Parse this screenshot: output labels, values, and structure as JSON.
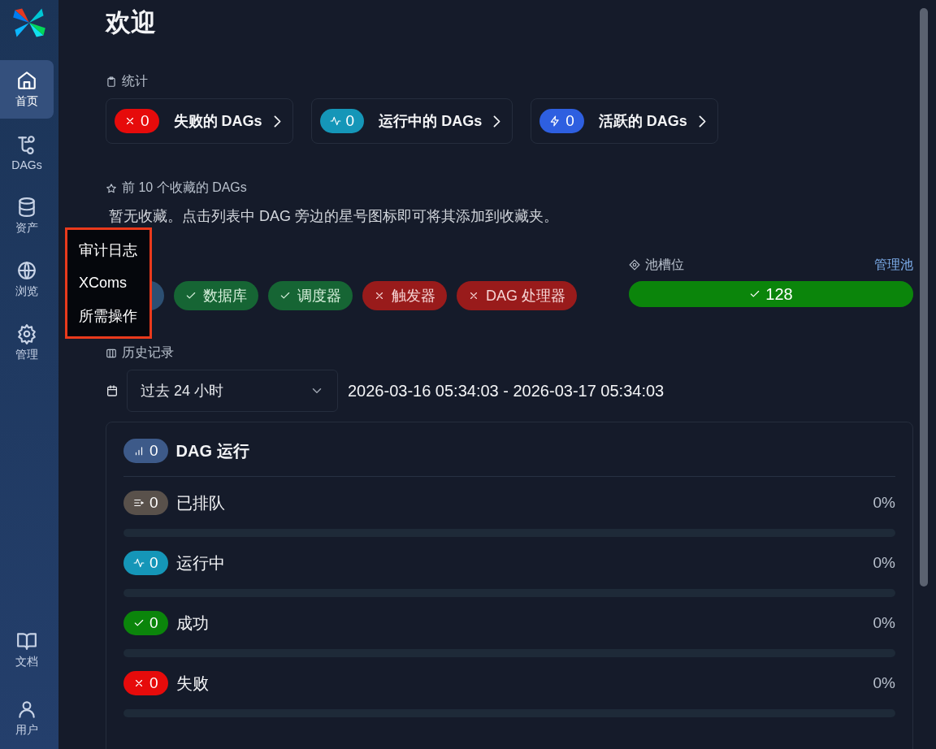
{
  "sidebar": {
    "items": [
      {
        "label": "首页",
        "selected": true
      },
      {
        "label": "DAGs",
        "selected": false
      },
      {
        "label": "资产",
        "selected": false
      },
      {
        "label": "浏览",
        "selected": false
      },
      {
        "label": "管理",
        "selected": false
      }
    ],
    "bottom_items": [
      {
        "label": "文档",
        "selected": false
      },
      {
        "label": "用户",
        "selected": false
      }
    ]
  },
  "popup_menu": {
    "items": [
      "审计日志",
      "XComs",
      "所需操作"
    ]
  },
  "title": "欢迎",
  "stats": {
    "heading": "统计",
    "cards": [
      {
        "kind": "failed",
        "count": "0",
        "label": "失败的 DAGs"
      },
      {
        "kind": "running",
        "count": "0",
        "label": "运行中的 DAGs"
      },
      {
        "kind": "active",
        "count": "0",
        "label": "活跃的 DAGs"
      }
    ]
  },
  "favorites": {
    "heading": "前 10 个收藏的 DAGs",
    "message": "暂无收藏。点击列表中 DAG 旁边的星号图标即可将其添加到收藏夹。"
  },
  "health": {
    "pills": [
      {
        "kind": "covered"
      },
      {
        "kind": "ok",
        "label": "数据库"
      },
      {
        "kind": "ok",
        "label": "调度器"
      },
      {
        "kind": "error",
        "label": "触发器"
      },
      {
        "kind": "error",
        "label": "DAG 处理器"
      }
    ]
  },
  "pool_slots": {
    "heading": "池槽位",
    "link": "管理池",
    "value": "128",
    "level": 1
  },
  "history": {
    "heading": "历史记录",
    "range": "过去 24 小时",
    "period": "2026-03-16 05:34:03 - 2026-03-17 05:34:03",
    "summary": {
      "kind": "total",
      "count": "0",
      "label": "DAG 运行"
    },
    "rows": [
      {
        "kind": "queued",
        "count": "0",
        "label": "已排队",
        "percent": "0%",
        "level": 0
      },
      {
        "kind": "running",
        "count": "0",
        "label": "运行中",
        "percent": "0%",
        "level": 0
      },
      {
        "kind": "success",
        "count": "0",
        "label": "成功",
        "percent": "0%",
        "level": 0
      },
      {
        "kind": "failed",
        "count": "0",
        "label": "失败",
        "percent": "0%",
        "level": 0
      }
    ]
  }
}
